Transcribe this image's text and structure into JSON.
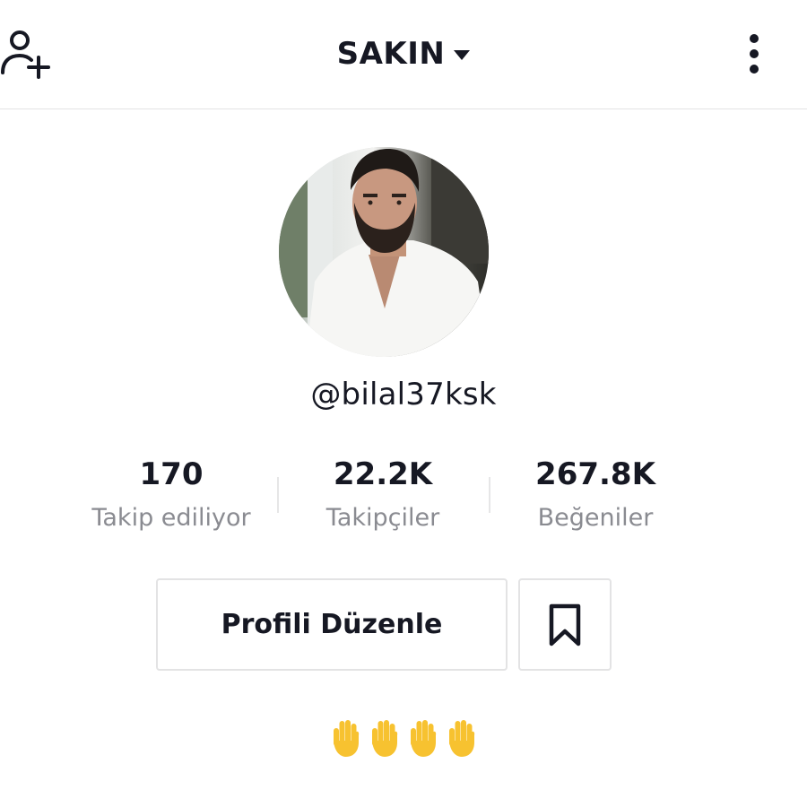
{
  "header": {
    "title": "SAKIN",
    "add_user_icon": "add-user-icon",
    "more_icon": "more-vertical-icon"
  },
  "profile": {
    "avatar_icon": "avatar",
    "username": "@bilal37ksk"
  },
  "stats": [
    {
      "value": "170",
      "label": "Takip ediliyor"
    },
    {
      "value": "22.2K",
      "label": "Takipçiler"
    },
    {
      "value": "267.8K",
      "label": "Beğeniler"
    }
  ],
  "actions": {
    "edit_profile_label": "Profili Düzenle",
    "bookmark_icon": "bookmark-icon"
  },
  "bio": {
    "emoji_count": 4,
    "emoji": "raised-hand"
  },
  "colors": {
    "text_primary": "#161823",
    "text_secondary": "#8a8b91",
    "border": "#e3e3e4",
    "emoji_yellow": "#f7c230"
  }
}
